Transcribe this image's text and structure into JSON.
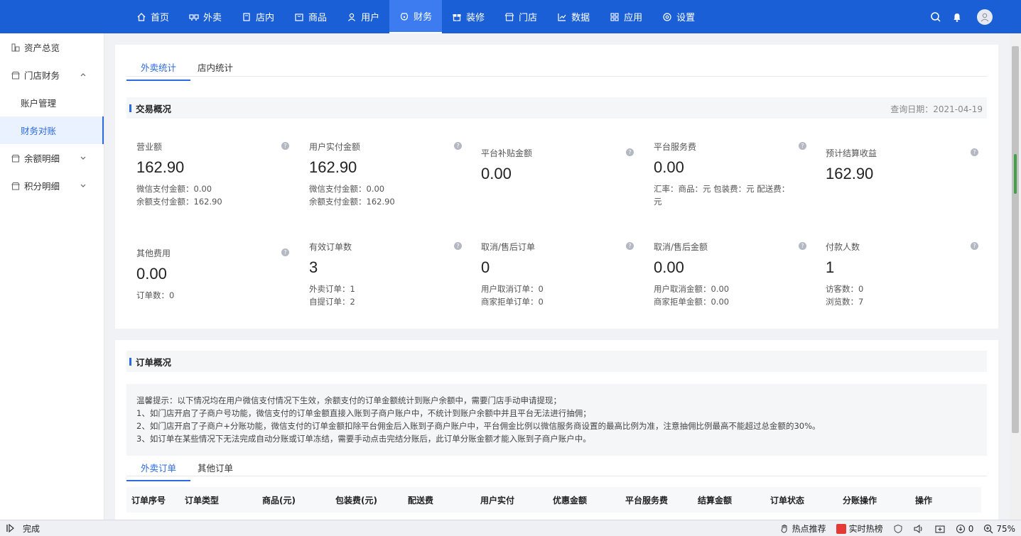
{
  "nav": {
    "items": [
      {
        "label": "首页",
        "icon": "home-icon"
      },
      {
        "label": "外卖",
        "icon": "delivery-icon"
      },
      {
        "label": "店内",
        "icon": "store-inside-icon"
      },
      {
        "label": "商品",
        "icon": "goods-icon"
      },
      {
        "label": "用户",
        "icon": "user-icon"
      },
      {
        "label": "财务",
        "icon": "finance-icon"
      },
      {
        "label": "装修",
        "icon": "decorate-icon"
      },
      {
        "label": "门店",
        "icon": "shop-icon"
      },
      {
        "label": "数据",
        "icon": "chart-icon"
      },
      {
        "label": "应用",
        "icon": "apps-icon"
      },
      {
        "label": "设置",
        "icon": "gear-icon"
      }
    ],
    "active": "财务",
    "colors": {
      "bar": "#1b5fd6",
      "active": "#3c7cf0"
    }
  },
  "sidebar": {
    "items": [
      {
        "label": "资产总览"
      },
      {
        "label": "门店财务"
      },
      {
        "label": "账户管理"
      },
      {
        "label": "财务对账"
      },
      {
        "label": "余额明细"
      },
      {
        "label": "积分明细"
      }
    ]
  },
  "stats_card": {
    "tabs": [
      "外卖统计",
      "店内统计"
    ],
    "section_title": "交易概况",
    "date_label": "查询日期：2021-04-19",
    "row1": [
      {
        "label": "营业额",
        "value": "162.90",
        "sub": [
          "微信支付金额：0.00",
          "余额支付金额：162.90"
        ]
      },
      {
        "label": "用户实付金额",
        "value": "162.90",
        "sub": [
          "微信支付金额：0.00",
          "余额支付金额：162.90"
        ]
      },
      {
        "label": "平台补贴金额",
        "value": "0.00",
        "sub": []
      },
      {
        "label": "平台服务费",
        "value": "0.00",
        "sub": [
          "汇率：商品：元 包装费：元 配送费：",
          "元"
        ]
      },
      {
        "label": "预计结算收益",
        "value": "162.90",
        "sub": []
      }
    ],
    "row2": [
      {
        "label": "其他费用",
        "value": "0.00",
        "sub": [
          "订单数：0"
        ]
      },
      {
        "label": "有效订单数",
        "value": "3",
        "sub": [
          "外卖订单：1",
          "自提订单：2"
        ]
      },
      {
        "label": "取消/售后订单",
        "value": "0",
        "sub": [
          "用户取消订单：0",
          "商家拒单订单：0"
        ]
      },
      {
        "label": "取消/售后金额",
        "value": "0.00",
        "sub": [
          "用户取消金额：0.00",
          "商家拒单金额：0.00"
        ]
      },
      {
        "label": "付款人数",
        "value": "1",
        "sub": [
          "访客数：0",
          "浏览数：7"
        ]
      }
    ]
  },
  "orders_card": {
    "section_title": "订单概况",
    "notice": [
      "温馨提示：以下情况均在用户微信支付情况下生效，余额支付的订单金额统计到账户余额中，需要门店手动申请提现；",
      "1、如门店开启了子商户号功能，微信支付的订单金额直接入账到子商户账户中，不统计到账户余额中并且平台无法进行抽佣；",
      "2、如门店开启了子商户+分账功能，微信支付的订单金额扣除平台佣金后入账到子商户账户中，平台佣金比例以微信服务商设置的最高比例为准，注意抽佣比例最高不能超过总金额的30%。",
      "3、如订单在某些情况下无法完成自动分账或订单冻结，需要手动点击完结分账后，此订单分账金额才能入账到子商户账户中。"
    ],
    "tabs": [
      "外卖订单",
      "其他订单"
    ],
    "columns": [
      "订单序号",
      "订单类型",
      "商品(元)",
      "包装费(元)",
      "配送费",
      "用户实付",
      "优惠金额",
      "平台服务费",
      "结算金额",
      "订单状态",
      "分账操作",
      "操作"
    ]
  },
  "statusbar": {
    "status": "完成",
    "hot": "热点推荐",
    "realtime": "实时热榜",
    "count": "0",
    "zoom": "75%"
  }
}
